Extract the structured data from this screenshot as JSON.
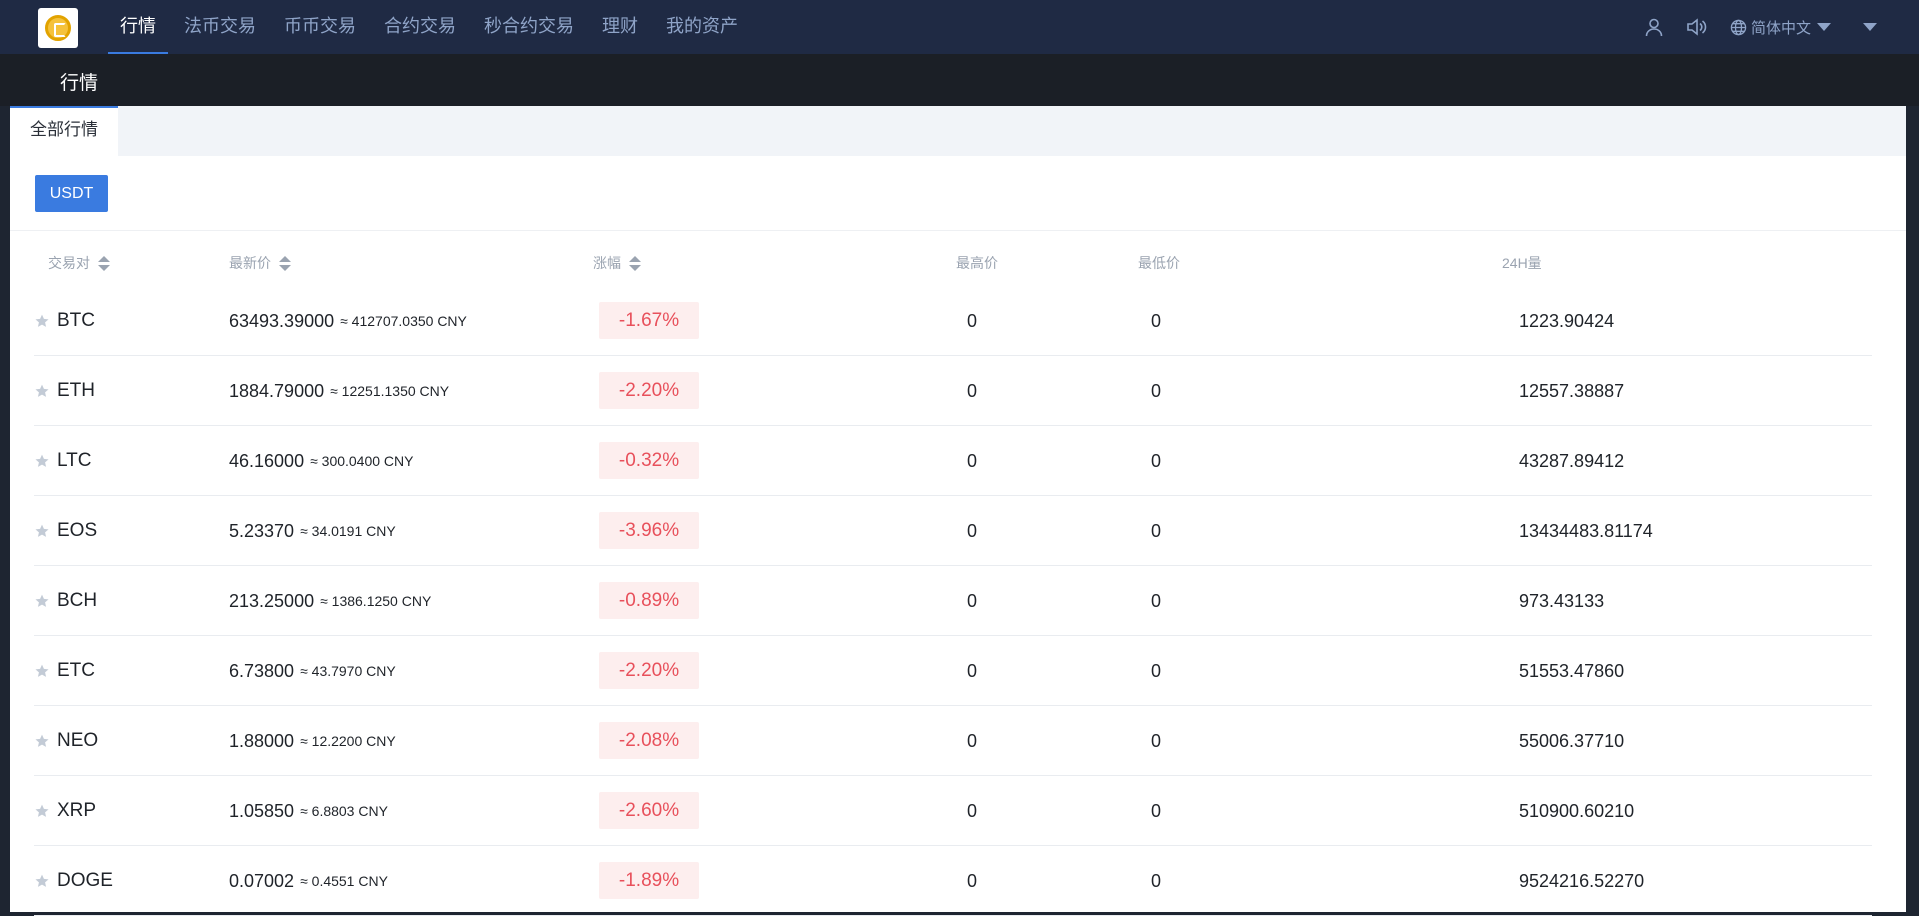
{
  "nav": {
    "items": [
      {
        "label": "行情",
        "active": true
      },
      {
        "label": "法币交易",
        "active": false
      },
      {
        "label": "币币交易",
        "active": false
      },
      {
        "label": "合约交易",
        "active": false
      },
      {
        "label": "秒合约交易",
        "active": false
      },
      {
        "label": "理财",
        "active": false
      },
      {
        "label": "我的资产",
        "active": false
      }
    ],
    "language": "简体中文",
    "icons": [
      "user-icon",
      "speaker-icon",
      "globe-icon",
      "chevron-down-icon"
    ]
  },
  "subbar": {
    "title": "行情"
  },
  "tabs": {
    "all_market": "全部行情"
  },
  "filter": {
    "usdt": "USDT"
  },
  "table": {
    "headers": {
      "pair": "交易对",
      "latest_price": "最新价",
      "change": "涨幅",
      "high": "最高价",
      "low": "最低价",
      "volume_24h": "24H量"
    },
    "rows": [
      {
        "pair": "BTC",
        "price": "63493.39000",
        "cny": "≈ 412707.0350 CNY",
        "change": "-1.67%",
        "high": "0",
        "low": "0",
        "volume": "1223.90424"
      },
      {
        "pair": "ETH",
        "price": "1884.79000",
        "cny": "≈ 12251.1350 CNY",
        "change": "-2.20%",
        "high": "0",
        "low": "0",
        "volume": "12557.38887"
      },
      {
        "pair": "LTC",
        "price": "46.16000",
        "cny": "≈ 300.0400 CNY",
        "change": "-0.32%",
        "high": "0",
        "low": "0",
        "volume": "43287.89412"
      },
      {
        "pair": "EOS",
        "price": "5.23370",
        "cny": "≈ 34.0191 CNY",
        "change": "-3.96%",
        "high": "0",
        "low": "0",
        "volume": "13434483.81174"
      },
      {
        "pair": "BCH",
        "price": "213.25000",
        "cny": "≈ 1386.1250 CNY",
        "change": "-0.89%",
        "high": "0",
        "low": "0",
        "volume": "973.43133"
      },
      {
        "pair": "ETC",
        "price": "6.73800",
        "cny": "≈ 43.7970 CNY",
        "change": "-2.20%",
        "high": "0",
        "low": "0",
        "volume": "51553.47860"
      },
      {
        "pair": "NEO",
        "price": "1.88000",
        "cny": "≈ 12.2200 CNY",
        "change": "-2.08%",
        "high": "0",
        "low": "0",
        "volume": "55006.37710"
      },
      {
        "pair": "XRP",
        "price": "1.05850",
        "cny": "≈ 6.8803 CNY",
        "change": "-2.60%",
        "high": "0",
        "low": "0",
        "volume": "510900.60210"
      },
      {
        "pair": "DOGE",
        "price": "0.07002",
        "cny": "≈ 0.4551 CNY",
        "change": "-1.89%",
        "high": "0",
        "low": "0",
        "volume": "9524216.52270"
      }
    ]
  },
  "colors": {
    "nav_bg": "#1f2a44",
    "accent": "#3a7be0",
    "negative": "#e8505b",
    "negative_bg": "#fdeeee"
  }
}
